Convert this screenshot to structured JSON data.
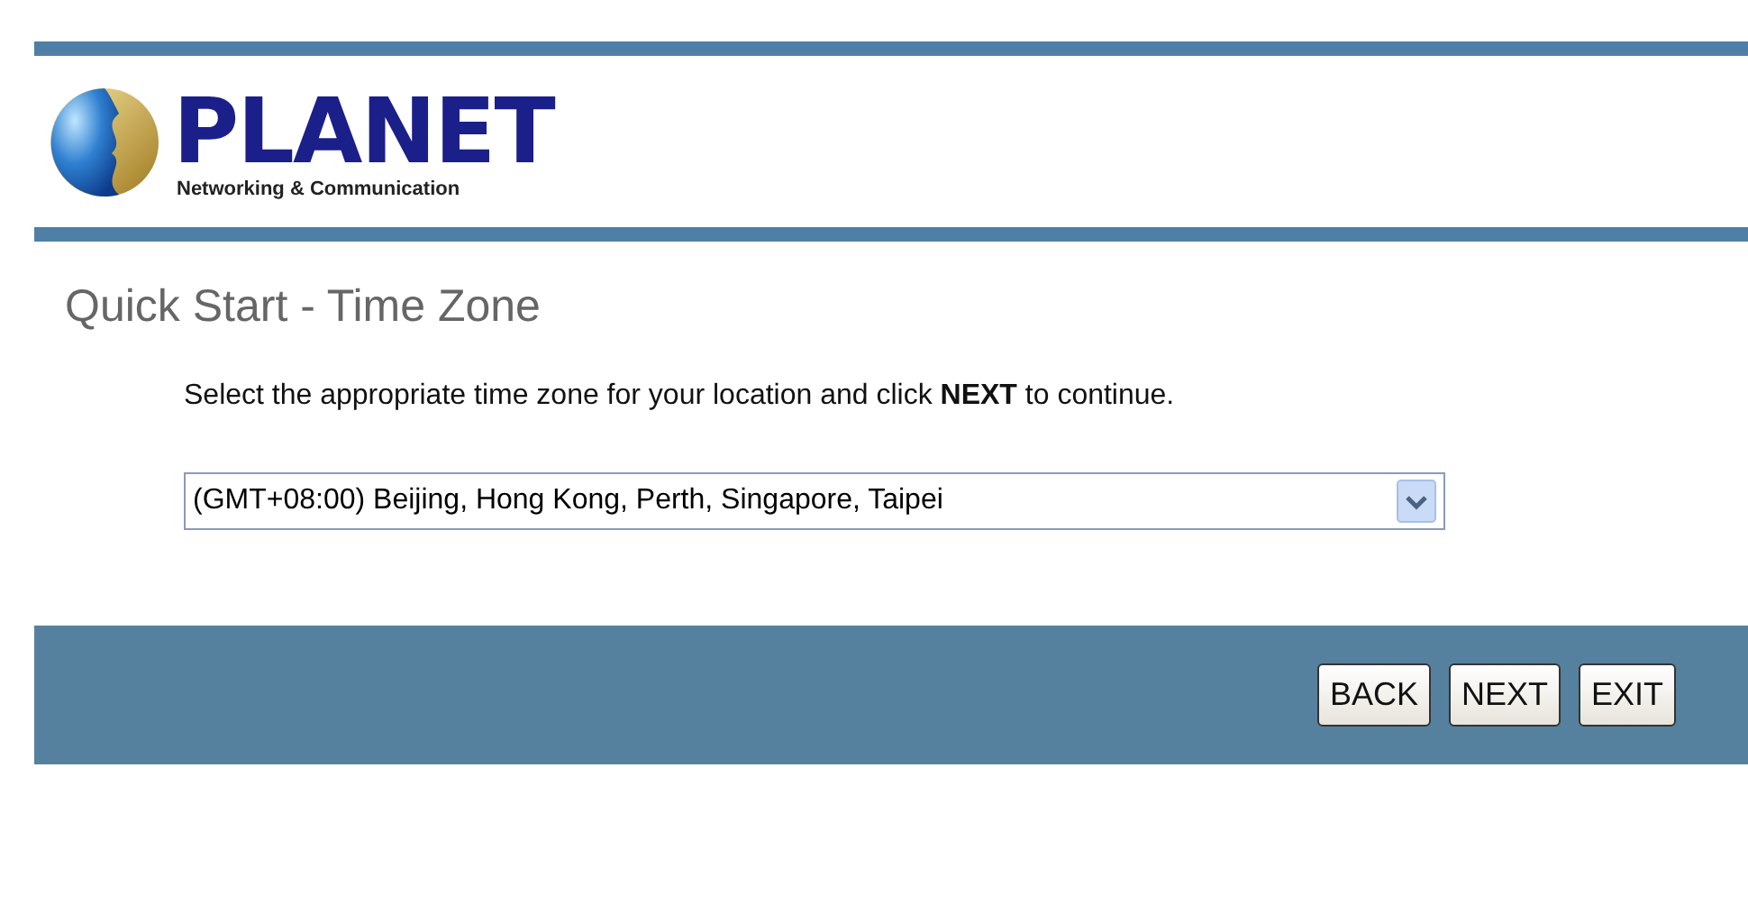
{
  "logo": {
    "name": "PLANET",
    "tagline": "Networking & Communication"
  },
  "title": "Quick Start - Time Zone",
  "instruction": "Select the appropriate time zone for your location and click **NEXT** to continue.",
  "timezone_select": {
    "value": "(GMT+08:00) Beijing, Hong Kong, Perth, Singapore, Taipei"
  },
  "buttons": [
    "BACK",
    "NEXT",
    "EXIT"
  ]
}
